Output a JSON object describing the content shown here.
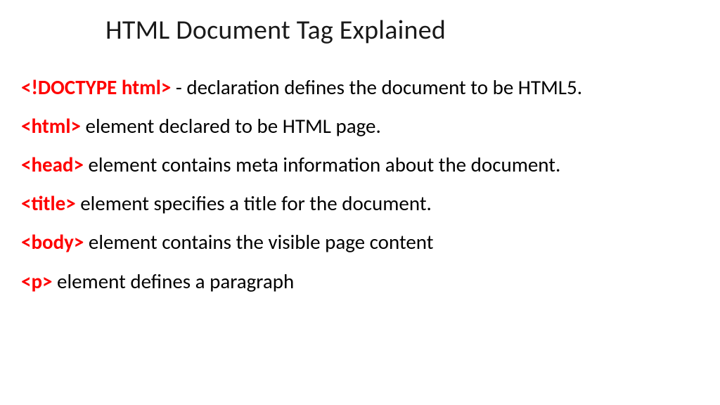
{
  "title": "HTML Document Tag Explained",
  "items": [
    {
      "tag": "<!DOCTYPE html>",
      "desc": " - declaration defines the document to be HTML5."
    },
    {
      "tag": "<html>",
      "desc": " element declared to be HTML page."
    },
    {
      "tag": "<head>",
      "desc": " element contains meta information about the document."
    },
    {
      "tag": "<title>",
      "desc": " element specifies a title for the document."
    },
    {
      "tag": "<body>",
      "desc": " element contains the visible page content"
    },
    {
      "tag": "<p>",
      "desc": " element defines a paragraph"
    }
  ]
}
